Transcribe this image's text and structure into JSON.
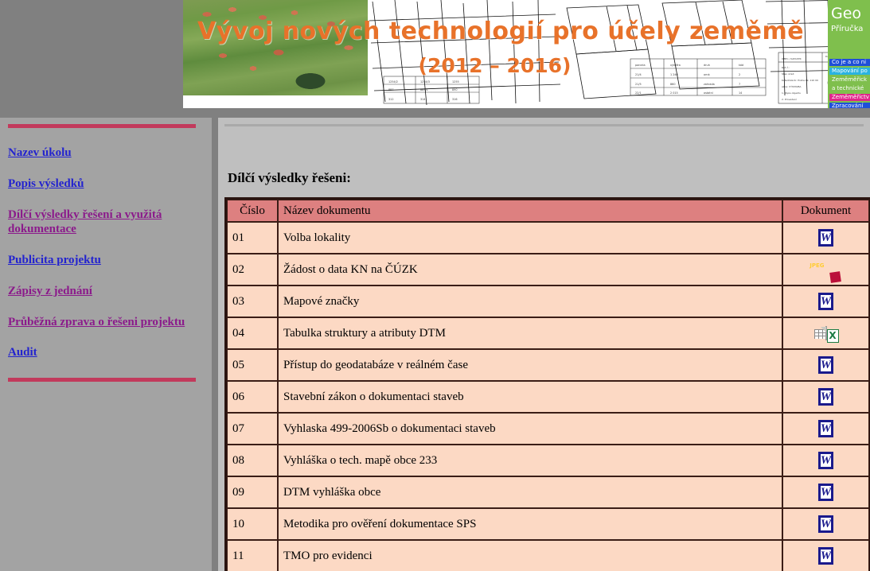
{
  "banner": {
    "title": "Vývoj nových technologií pro účely zeměmě",
    "years": "(2012 – 2016)",
    "book": {
      "title": "Geo",
      "subtitle": "Příručka",
      "bars": [
        "Co je a co ni",
        "Mapování po",
        "Zeměměřick",
        "a technické",
        "Zeměměřictv",
        "Zpracování"
      ],
      "bar_colors": [
        "#1f4fd8",
        "#2ab3e0",
        "#7fbf4d",
        "#7fbf4d",
        "#e0268a",
        "#1f4fd8"
      ]
    },
    "colors": {
      "title_orange": "#e8722a",
      "book_green": "#7fbf4d"
    }
  },
  "sidebar": {
    "items": [
      {
        "label": "Nazev úkolu",
        "color": "blue"
      },
      {
        "label": "Popis výsledků",
        "color": "blue"
      },
      {
        "label": "Dílčí výsledky řešení a využitá dokumentace",
        "color": "purple"
      },
      {
        "label": "Publicita projektu",
        "color": "blue"
      },
      {
        "label": "Zápisy z jednání",
        "color": "purple"
      },
      {
        "label": "Průběžná zprava o řešeni projektu",
        "color": "purple"
      },
      {
        "label": "Audit",
        "color": "blue"
      }
    ],
    "colors": {
      "background": "#a3a3a3",
      "rule": "#c23a5c",
      "link_blue": "#2323cf",
      "link_purple": "#8b1a8b"
    }
  },
  "main": {
    "heading": "Dílčí výsledky řešeni:",
    "colors": {
      "background": "#bfbfbf",
      "rule": "#a9a9a9",
      "table_header": "#dd8080",
      "table_cell": "#fcd9c4",
      "table_border": "#2a1410"
    },
    "table": {
      "columns": [
        "Číslo",
        "Název dokumentu",
        "Dokument"
      ],
      "rows": [
        {
          "number": "01",
          "name": "Volba lokality",
          "doc": "word"
        },
        {
          "number": "02",
          "name": "Žádost o data KN na ČÚZK",
          "doc": "jpeg"
        },
        {
          "number": "03",
          "name": "Mapové značky",
          "doc": "word"
        },
        {
          "number": "04",
          "name": "Tabulka struktury a atributy DTM",
          "doc": "excel"
        },
        {
          "number": "05",
          "name": "Přístup do geodatabáze v reálném čase",
          "doc": "word"
        },
        {
          "number": "06",
          "name": "Stavební zákon o dokumentaci staveb",
          "doc": "word"
        },
        {
          "number": "07",
          "name": "Vyhlaska 499-2006Sb o dokumentaci staveb",
          "doc": "word"
        },
        {
          "number": "08",
          "name": "Vyhláška o tech. mapě obce 233",
          "doc": "word"
        },
        {
          "number": "09",
          "name": "DTM vyhláška obce",
          "doc": "word"
        },
        {
          "number": "10",
          "name": "Metodika pro ověření dokumentace SPS",
          "doc": "word"
        },
        {
          "number": "11",
          "name": "TMO pro evidenci",
          "doc": "word"
        }
      ],
      "doc_icon_labels": {
        "word": "W",
        "jpeg": "JPEG",
        "excel": "X"
      }
    }
  }
}
